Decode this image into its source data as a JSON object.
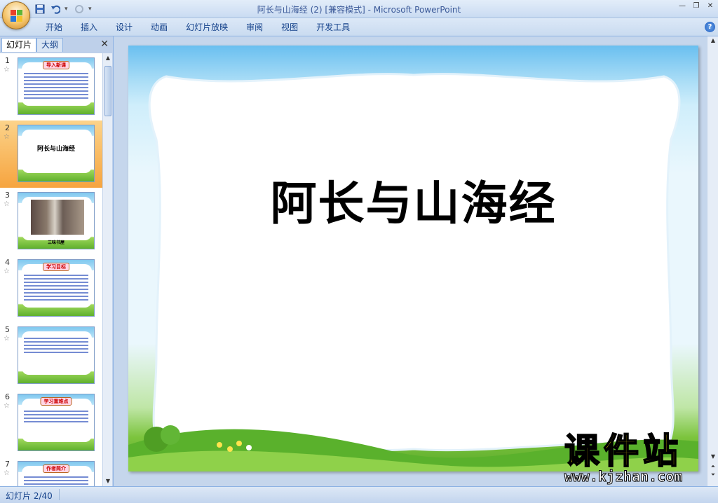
{
  "window": {
    "title": "阿长与山海经 (2) [兼容模式] - Microsoft PowerPoint"
  },
  "quick_access": {
    "items": [
      "save-icon",
      "undo-icon",
      "redo-icon",
      "customize-icon"
    ]
  },
  "ribbon": {
    "tabs": [
      "开始",
      "插入",
      "设计",
      "动画",
      "幻灯片放映",
      "审阅",
      "视图",
      "开发工具"
    ]
  },
  "panel": {
    "tabs": [
      "幻灯片",
      "大纲"
    ],
    "close_icon": "close-icon"
  },
  "thumbnails": [
    {
      "number": "1",
      "title": "导入新课",
      "selected": false
    },
    {
      "number": "2",
      "title": "阿长与山海经",
      "selected": true
    },
    {
      "number": "3",
      "title": "",
      "caption": "三味书屋",
      "selected": false
    },
    {
      "number": "4",
      "title": "学习目标",
      "selected": false
    },
    {
      "number": "5",
      "title": "",
      "selected": false
    },
    {
      "number": "6",
      "title": "学习重难点",
      "selected": false
    },
    {
      "number": "7",
      "title": "作者简介",
      "selected": false
    }
  ],
  "slide": {
    "title": "阿长与山海经"
  },
  "watermark": {
    "text": "课件站",
    "url": "www.kjzhan.com"
  },
  "status": {
    "slide_indicator": "幻灯片 2/40"
  },
  "colors": {
    "ribbon_text": "#15428b",
    "selected_thumb": "#f6a43f",
    "watermark_yellow": "#ffe100"
  }
}
